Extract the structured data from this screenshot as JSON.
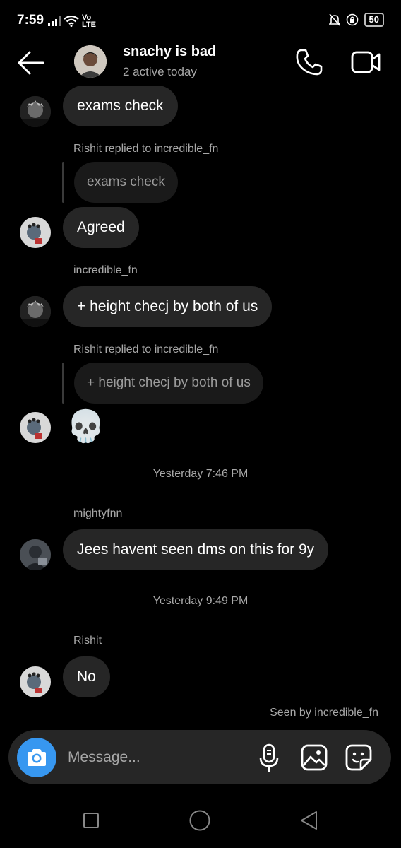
{
  "status_bar": {
    "time": "7:59",
    "network": "Vo\nLTE",
    "battery": "50"
  },
  "header": {
    "title": "snachy is bad",
    "subtitle": "2 active today"
  },
  "messages": {
    "m1_text": "exams check",
    "m2_meta": "Rishit replied to incredible_fn",
    "m2_quote": "exams check",
    "m2_text": "Agreed",
    "m3_meta": "incredible_fn",
    "m3_text": "+ height checj by both of us",
    "m4_meta": "Rishit replied to incredible_fn",
    "m4_quote": "+ height checj by both of us",
    "m4_emoji": "💀",
    "ts1": "Yesterday 7:46 PM",
    "m5_meta": "mightyfnn",
    "m5_text": "Jees havent seen dms on this for 9y",
    "ts2": "Yesterday 9:49 PM",
    "m6_meta": "Rishit",
    "m6_text": "No",
    "seen": "Seen by incredible_fn"
  },
  "composer": {
    "placeholder": "Message..."
  },
  "icons": {
    "back": "back-arrow-icon",
    "call": "phone-icon",
    "video": "video-camera-icon",
    "camera": "camera-icon",
    "mic": "microphone-icon",
    "gallery": "gallery-icon",
    "sticker": "sticker-icon"
  },
  "colors": {
    "background": "#000000",
    "bubble": "#262626",
    "accent": "#3797f0",
    "muted_text": "#a8a8a8"
  }
}
